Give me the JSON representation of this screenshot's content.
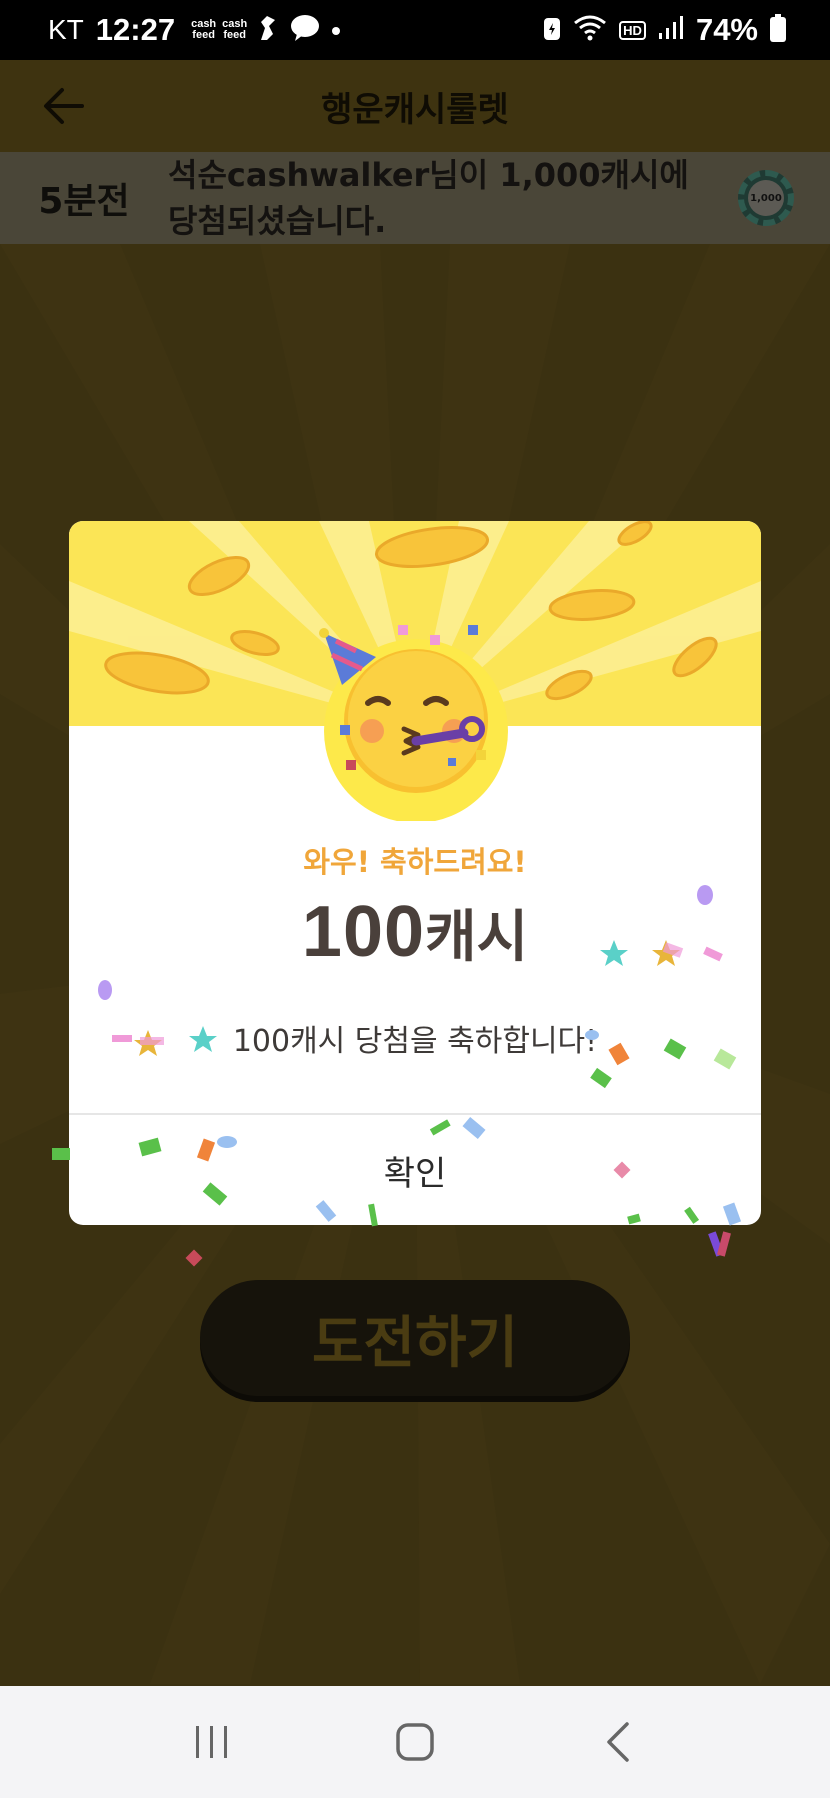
{
  "status_bar": {
    "carrier": "KT",
    "time": "12:27",
    "app_icons": [
      "cash feed",
      "cash feed"
    ],
    "battery": "74%",
    "hd": "HD"
  },
  "header": {
    "title": "행운캐시룰렛"
  },
  "ticker": {
    "time_ago": "5분전",
    "message": "석순cashwalker님이 1,000캐시에 당첨되셨습니다.",
    "chip_label": "1,000"
  },
  "main": {
    "challenge_label": "도전하기"
  },
  "dialog": {
    "subtitle": "와우! 축하드려요!",
    "amount_number": "100",
    "amount_unit": "캐시",
    "message": "100캐시 당첨을 축하합니다!",
    "confirm_label": "확인",
    "accent_color": "#f0a63a",
    "top_color": "#fbe556"
  },
  "navbar": {
    "icons": [
      "recent-apps-icon",
      "home-icon",
      "back-icon"
    ]
  }
}
